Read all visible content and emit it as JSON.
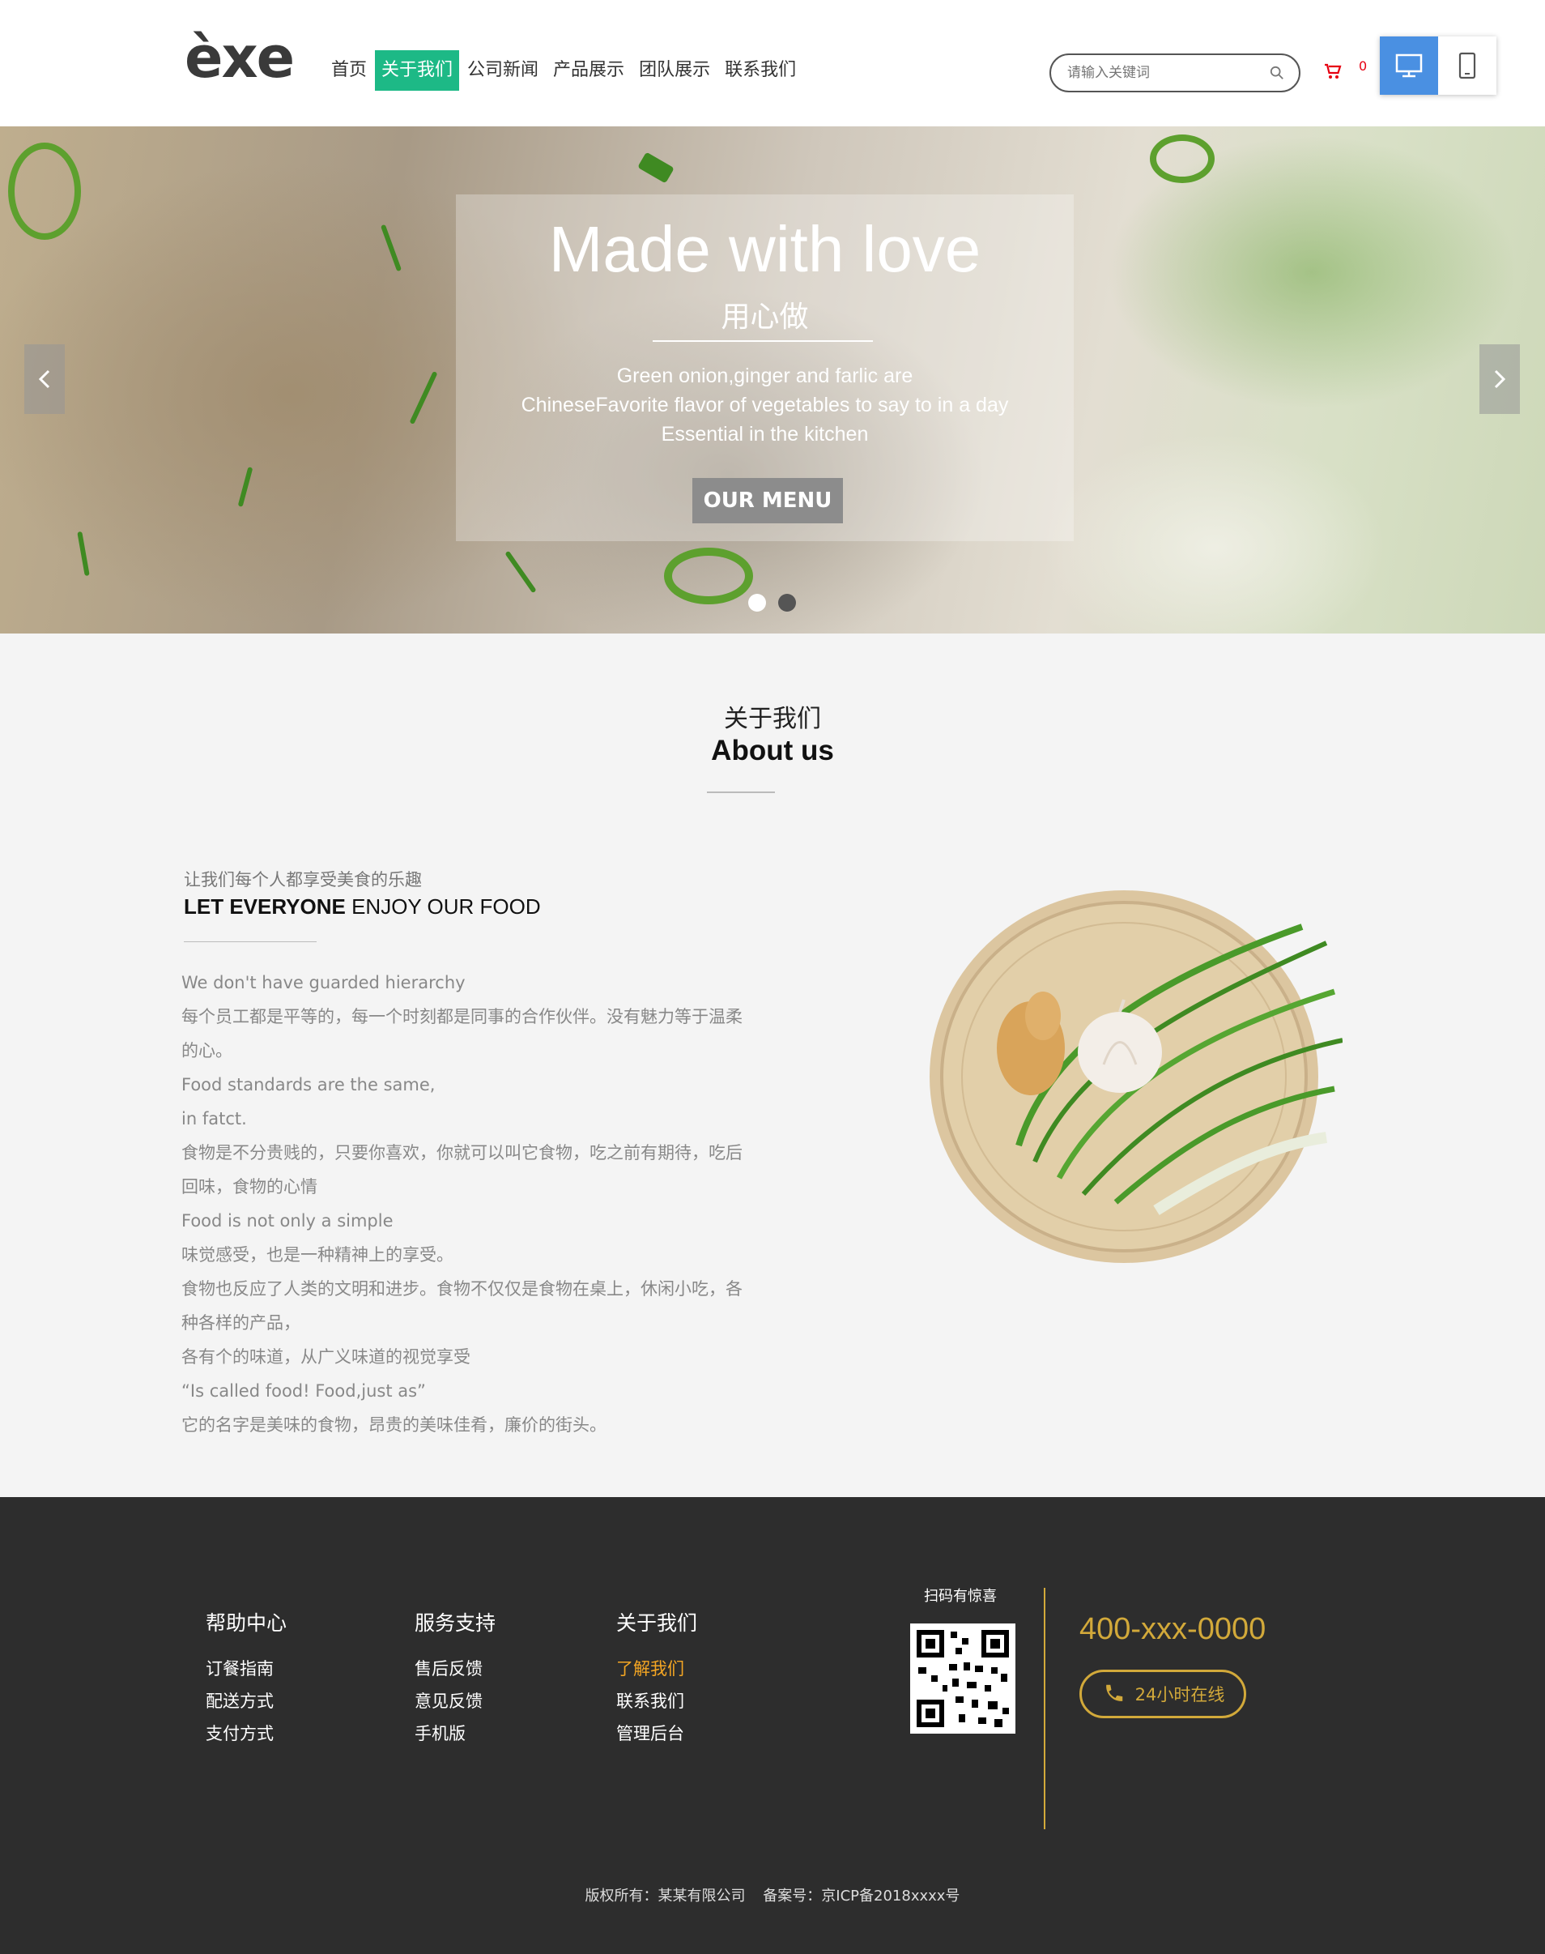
{
  "header": {
    "logo": "èxe",
    "nav": [
      "首页",
      "关于我们",
      "公司新闻",
      "产品展示",
      "团队展示",
      "联系我们"
    ],
    "active_nav": "关于我们",
    "search_placeholder": "请输入关键词",
    "cart_count": "0"
  },
  "banner": {
    "title": "Made with love",
    "subtitle": "用心做",
    "desc_lines": [
      "Green onion,ginger and farlic are",
      "ChineseFavorite flavor of vegetables to say to in a day",
      "Essential in the kitchen"
    ],
    "button": "OUR MENU"
  },
  "about": {
    "heading_cn": "关于我们",
    "heading_en": "About us",
    "small": "让我们每个人都享受美食的乐趣",
    "title_bold": "LET EVERYONE",
    "title_rest": " ENJOY OUR FOOD",
    "paragraphs": [
      "We don't have guarded hierarchy",
      "每个员工都是平等的，每一个时刻都是同事的合作伙伴。没有魅力等于温柔",
      "的心。",
      "Food standards are the same,",
      "in fatct.",
      "食物是不分贵贱的，只要你喜欢，你就可以叫它食物，吃之前有期待，吃后",
      "回味，食物的心情",
      "Food is not only a simple",
      "味觉感受，也是一种精神上的享受。",
      "食物也反应了人类的文明和进步。食物不仅仅是食物在桌上，休闲小吃，各",
      "种各样的产品，",
      "各有个的味道，从广义味道的视觉享受",
      "“Is called food! Food,just as”",
      "它的名字是美味的食物，昂贵的美味佳肴，廉价的街头。"
    ]
  },
  "footer": {
    "columns": [
      {
        "title": "帮助中心",
        "items": [
          "订餐指南",
          "配送方式",
          "支付方式"
        ]
      },
      {
        "title": "服务支持",
        "items": [
          "售后反馈",
          "意见反馈",
          "手机版"
        ]
      },
      {
        "title": "关于我们",
        "items": [
          "了解我们",
          "联系我们",
          "管理后台"
        ]
      }
    ],
    "qr_label": "扫码有惊喜",
    "phone": "400-xxx-0000",
    "online": "24小时在线",
    "copyright_owner": "版权所有：某某有限公司",
    "copyright_icp": "备案号：京ICP备2018xxxx号",
    "accent_color": "#d2a93a"
  }
}
